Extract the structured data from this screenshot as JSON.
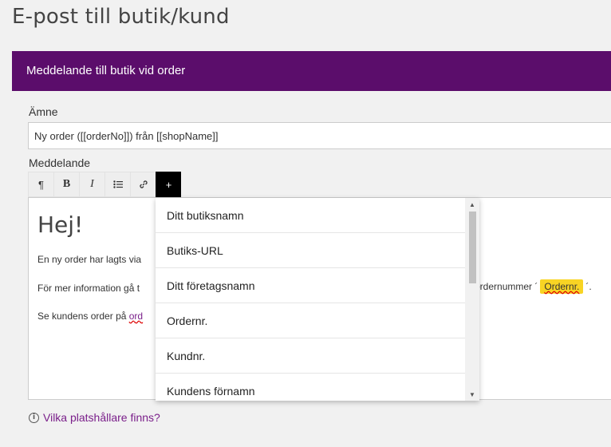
{
  "page": {
    "title": "E-post till butik/kund"
  },
  "panel": {
    "header": "Meddelande till butik vid order"
  },
  "subject": {
    "label": "Ämne",
    "value": "Ny order ([[orderNo]]) från [[shopName]]"
  },
  "message": {
    "label": "Meddelande",
    "toolbar": {
      "paragraph": "¶",
      "bold": "B",
      "italic": "I",
      "list": "☰",
      "link": "🔗",
      "insert": "+"
    },
    "editor": {
      "greeting": "Hej!",
      "line1": "En ny order har lagts via",
      "line2": "För mer information gå t",
      "line2_tail_pre": "ordernummer ´",
      "line2_chip": "Ordernr.",
      "line2_tail_post": "´.",
      "line3_pre": "Se kundens order på ",
      "line3_link": "ord"
    }
  },
  "dropdown": {
    "items": [
      "Ditt butiksnamn",
      "Butiks-URL",
      "Ditt företagsnamn",
      "Ordernr.",
      "Kundnr.",
      "Kundens förnamn"
    ]
  },
  "help": {
    "label": "Vilka platshållare finns?",
    "icon": "info-icon"
  },
  "colors": {
    "header_bg": "#5b0d6b",
    "link": "#7a1f8a",
    "chip": "#f8d424"
  }
}
